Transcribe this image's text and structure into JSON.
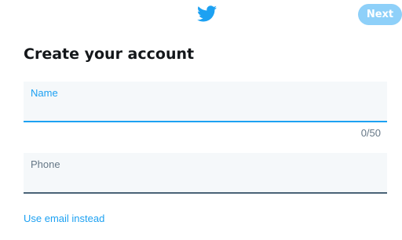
{
  "header": {
    "logo_icon": "twitter-bird-icon",
    "next_label": "Next"
  },
  "title": "Create your account",
  "name_field": {
    "label": "Name",
    "value": "",
    "counter": "0/50"
  },
  "phone_field": {
    "label": "Phone",
    "value": ""
  },
  "alt_link": "Use email instead",
  "colors": {
    "brand": "#1da1f2",
    "next_button_disabled": "#8ed0f9",
    "field_background": "#f5f8fa",
    "muted_text": "#657786"
  }
}
